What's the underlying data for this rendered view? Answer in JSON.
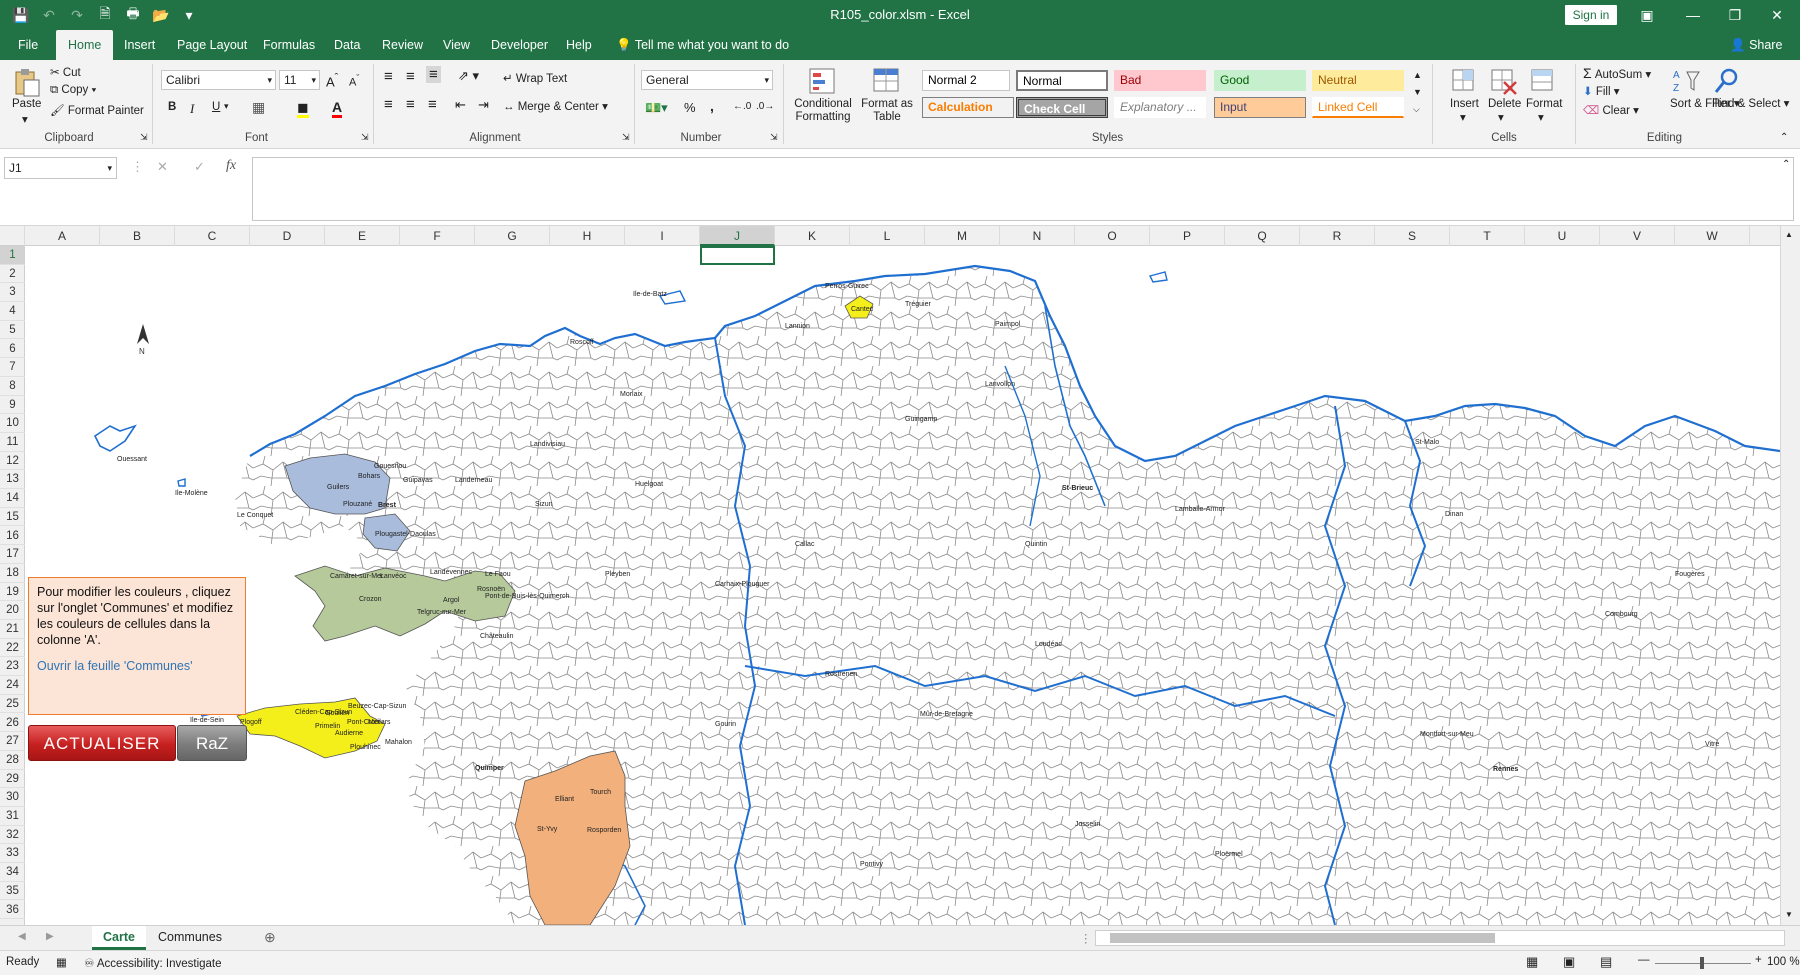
{
  "window": {
    "title": "R105_color.xlsm  -  Excel",
    "sign_in": "Sign in",
    "share": "Share"
  },
  "ribbon_tabs": [
    "File",
    "Home",
    "Insert",
    "Page Layout",
    "Formulas",
    "Data",
    "Review",
    "View",
    "Developer",
    "Help"
  ],
  "active_tab": "Home",
  "tell_me": "Tell me what you want to do",
  "clipboard": {
    "paste": "Paste",
    "cut": "Cut",
    "copy": "Copy",
    "format_painter": "Format Painter",
    "label": "Clipboard"
  },
  "font": {
    "name": "Calibri",
    "size": "11",
    "label": "Font",
    "bold": "B",
    "italic": "I",
    "underline": "U"
  },
  "alignment": {
    "wrap_text": "Wrap Text",
    "merge_center": "Merge & Center",
    "label": "Alignment"
  },
  "number": {
    "format": "General",
    "label": "Number",
    "percent": "%",
    "comma": ","
  },
  "styles": {
    "conditional_formatting": "Conditional Formatting",
    "format_as_table": "Format as Table",
    "cells": [
      {
        "label": "Normal 2",
        "bg": "#ffffff",
        "fg": "#000000",
        "border": "#c6c6c6"
      },
      {
        "label": "Normal",
        "bg": "#ffffff",
        "fg": "#000000",
        "border": "#7a7a7a"
      },
      {
        "label": "Bad",
        "bg": "#ffc7ce",
        "fg": "#9c0006",
        "border": "#ffc7ce"
      },
      {
        "label": "Good",
        "bg": "#c6efce",
        "fg": "#006100",
        "border": "#c6efce"
      },
      {
        "label": "Neutral",
        "bg": "#ffeb9c",
        "fg": "#9c5700",
        "border": "#ffeb9c"
      },
      {
        "label": "Calculation",
        "bg": "#f2f2f2",
        "fg": "#fa7d00",
        "border": "#7f7f7f"
      },
      {
        "label": "Check Cell",
        "bg": "#a5a5a5",
        "fg": "#ffffff",
        "border": "#3f3f3f"
      },
      {
        "label": "Explanatory ...",
        "bg": "#ffffff",
        "fg": "#7f7f7f",
        "border": "#ffffff"
      },
      {
        "label": "Input",
        "bg": "#ffcc99",
        "fg": "#3f3f76",
        "border": "#7f7f7f"
      },
      {
        "label": "Linked Cell",
        "bg": "#ffffff",
        "fg": "#fa7d00",
        "border": "#ffffff"
      }
    ],
    "label": "Styles"
  },
  "cells_group": {
    "insert": "Insert",
    "delete": "Delete",
    "format": "Format",
    "label": "Cells"
  },
  "editing": {
    "autosum": "AutoSum",
    "fill": "Fill",
    "clear": "Clear",
    "sort_filter": "Sort & Filter",
    "find_select": "Find & Select",
    "label": "Editing"
  },
  "formula_bar": {
    "name_box": "J1",
    "fx": "fx",
    "content": ""
  },
  "columns": [
    "A",
    "B",
    "C",
    "D",
    "E",
    "F",
    "G",
    "H",
    "I",
    "J",
    "K",
    "L",
    "M",
    "N",
    "O",
    "P",
    "Q",
    "R",
    "S",
    "T",
    "U",
    "V",
    "W"
  ],
  "selected_column": "J",
  "rows": [
    "1",
    "2",
    "3",
    "4",
    "5",
    "6",
    "7",
    "8",
    "9",
    "10",
    "11",
    "12",
    "13",
    "14",
    "15",
    "16",
    "17",
    "18",
    "19",
    "20",
    "21",
    "22",
    "23",
    "24",
    "25",
    "26",
    "27",
    "28",
    "29",
    "30",
    "31",
    "32",
    "33",
    "34",
    "35",
    "36"
  ],
  "info_box": {
    "text": "Pour modifier les couleurs , cliquez sur l'onglet 'Communes' et modifiez les couleurs de cellules dans la colonne 'A'.",
    "link": "Ouvrir la feuille 'Communes'"
  },
  "buttons": {
    "actualiser": "ACTUALISER",
    "raz": "RaZ"
  },
  "map": {
    "north": "N",
    "labels": {
      "ouessant": "Ouessant",
      "molene": "Ile-Molène",
      "conquet": "Le Conquet",
      "sein": "Ile-de-Sein",
      "batz": "Ile-de-Batz",
      "brest": "Brest",
      "guilers": "Guilers",
      "gouesnou": "Gouesnou",
      "guipavas": "Guipavas",
      "bohars": "Bohars",
      "plouzane": "Plouzané",
      "plougastel": "Plougastel-Daoulas",
      "crozon": "Crozon",
      "camaret": "Camaret-sur-Mer",
      "lanveoc": "Lanvéoc",
      "landevennec": "Landévennec",
      "telgruc": "Telgruc-sur-Mer",
      "argol": "Argol",
      "rosnoen": "Rosnoën",
      "le_faou": "Le Faou",
      "pont_de_buis": "Pont-de-Buis-lès-Quimerch",
      "cleden": "Cléden-Cap-Sizun",
      "beuzec": "Beuzec-Cap-Sizun",
      "goulien": "Goulien",
      "plogoff": "Plogoff",
      "primelin": "Primelin",
      "audierne": "Audierne",
      "pont_croix": "Pont-Croix",
      "meilars": "Meilars",
      "plouhinec": "Plouhinec",
      "mahalon": "Mahalon",
      "cantec": "Cantec",
      "elliant": "Elliant",
      "tourch": "Tourch",
      "st_yvy": "St-Yvy",
      "rosporden": "Rosporden",
      "quimper": "Quimper",
      "st_brieuc": "St-Brieuc",
      "st_malo": "St-Malo",
      "rennes": "Rennes",
      "pontivy": "Pontivy",
      "landerneau": "Landerneau",
      "morlaix": "Morlaix",
      "lannion": "Lannion",
      "guingamp": "Guingamp",
      "carhaix": "Carhaix-Plouguer",
      "loudeac": "Loudéac",
      "dinan": "Dinan",
      "lamballe": "Lamballe-Armor",
      "fougeres": "Fougères",
      "vitre": "Vitré",
      "ploermel": "Ploërmel",
      "chateaulin": "Châteaulin",
      "paimpol": "Paimpol",
      "perros": "Perros-Guirec",
      "roscoff": "Roscoff",
      "combourg": "Combourg",
      "montfort": "Montfort-sur-Meu",
      "josselin": "Josselin",
      "quintin": "Quintin",
      "rostrenen": "Rostrenen",
      "gourin": "Gourin",
      "mur": "Mûr-de-Bretagne",
      "lanvollon": "Lanvollon",
      "treguier": "Tréguier",
      "landivisiau": "Landivisiau",
      "sizun": "Sizun",
      "huelgoat": "Huelgoat",
      "callac": "Callac",
      "pleyben": "Pleyben"
    },
    "zone_colors": {
      "brest": "#a9bcdc",
      "crozon": "#b5c99a",
      "cap_sizun": "#f4ee1a",
      "elliant": "#f2b07c",
      "cantec": "#f4ee1a",
      "coast": "#1f6fd1"
    }
  },
  "sheets": [
    "Carte",
    "Communes"
  ],
  "active_sheet": "Carte",
  "status": {
    "ready": "Ready",
    "accessibility": "Accessibility: Investigate",
    "zoom": "100 %"
  }
}
